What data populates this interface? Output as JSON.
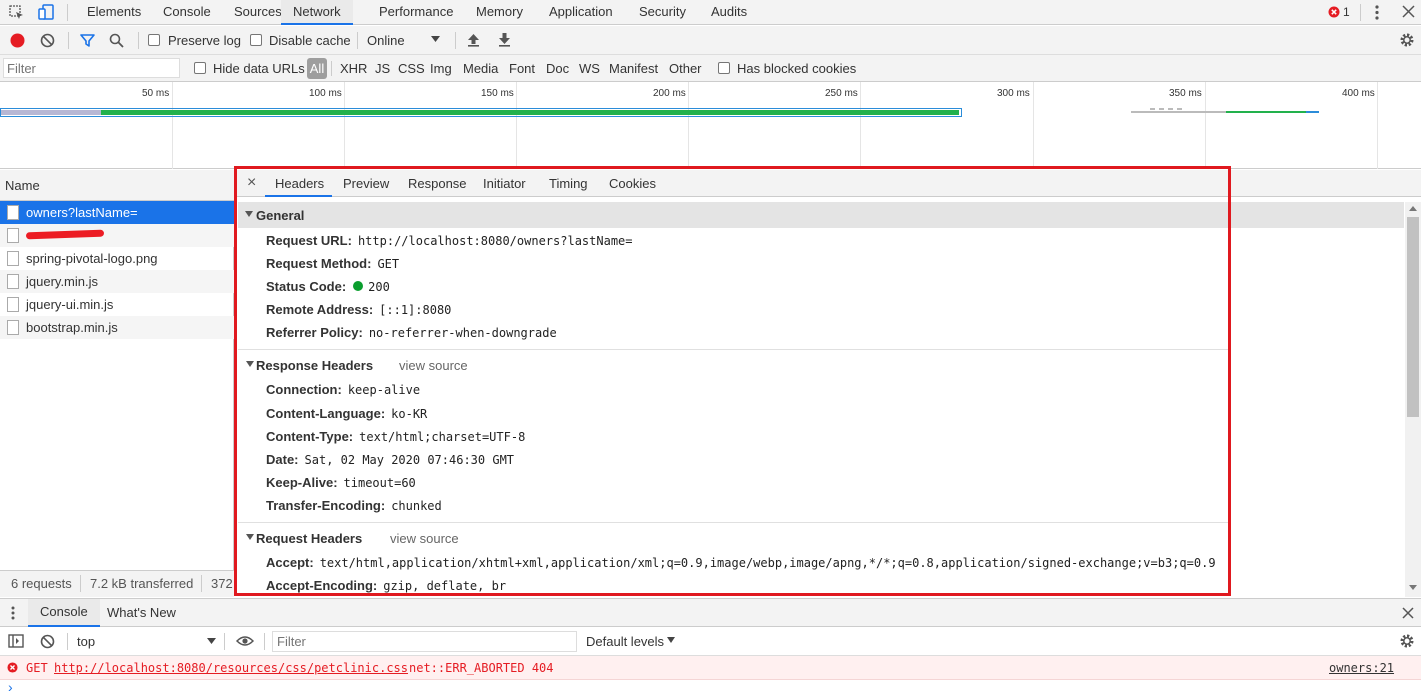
{
  "main_tabs": [
    "Elements",
    "Console",
    "Sources",
    "Network",
    "Performance",
    "Memory",
    "Application",
    "Security",
    "Audits"
  ],
  "error_count": "1",
  "toolbar": {
    "preserve_log": "Preserve log",
    "disable_cache": "Disable cache",
    "throttle": "Online"
  },
  "filterbar": {
    "filter_placeholder": "Filter",
    "hide_data_urls": "Hide data URLs",
    "types": [
      "All",
      "XHR",
      "JS",
      "CSS",
      "Img",
      "Media",
      "Font",
      "Doc",
      "WS",
      "Manifest",
      "Other"
    ],
    "has_blocked_cookies": "Has blocked cookies"
  },
  "overview": {
    "ticks": [
      "50 ms",
      "100 ms",
      "150 ms",
      "200 ms",
      "250 ms",
      "300 ms",
      "350 ms",
      "400 ms"
    ]
  },
  "requests": {
    "header": "Name",
    "items": [
      "owners?lastName=",
      "",
      "spring-pivotal-logo.png",
      "jquery.min.js",
      "jquery-ui.min.js",
      "bootstrap.min.js"
    ],
    "status": {
      "count": "6 requests",
      "transferred": "7.2 kB transferred",
      "extra": "372"
    }
  },
  "details": {
    "close": "×",
    "tabs": [
      "Headers",
      "Preview",
      "Response",
      "Initiator",
      "Timing",
      "Cookies"
    ],
    "general": {
      "title": "General",
      "rows": [
        {
          "k": "Request URL:",
          "v": "http://localhost:8080/owners?lastName="
        },
        {
          "k": "Request Method:",
          "v": "GET"
        },
        {
          "k": "Status Code:",
          "v": "200"
        },
        {
          "k": "Remote Address:",
          "v": "[::1]:8080"
        },
        {
          "k": "Referrer Policy:",
          "v": "no-referrer-when-downgrade"
        }
      ]
    },
    "response_headers": {
      "title": "Response Headers",
      "view_source": "view source",
      "rows": [
        {
          "k": "Connection:",
          "v": "keep-alive"
        },
        {
          "k": "Content-Language:",
          "v": "ko-KR"
        },
        {
          "k": "Content-Type:",
          "v": "text/html;charset=UTF-8"
        },
        {
          "k": "Date:",
          "v": "Sat, 02 May 2020 07:46:30 GMT"
        },
        {
          "k": "Keep-Alive:",
          "v": "timeout=60"
        },
        {
          "k": "Transfer-Encoding:",
          "v": "chunked"
        }
      ]
    },
    "request_headers": {
      "title": "Request Headers",
      "view_source": "view source",
      "rows": [
        {
          "k": "Accept:",
          "v": "text/html,application/xhtml+xml,application/xml;q=0.9,image/webp,image/apng,*/*;q=0.8,application/signed-exchange;v=b3;q=0.9"
        },
        {
          "k": "Accept-Encoding:",
          "v": "gzip, deflate, br"
        }
      ]
    }
  },
  "drawer": {
    "tabs": [
      "Console",
      "What's New"
    ],
    "context": "top",
    "filter_placeholder": "Filter",
    "levels": "Default levels",
    "error": {
      "method": "GET",
      "url": "http://localhost:8080/resources/css/petclinic.css",
      "message": "net::ERR_ABORTED 404",
      "source": "owners:21"
    },
    "prompt": "›"
  },
  "colors": {
    "accent": "#1a73e8",
    "record": "#e51c23",
    "highlight_box": "#e0191f",
    "status_ok": "#0a9e2e",
    "timeline_green": "#22b14c",
    "timeline_blue": "#2b8cd9"
  }
}
